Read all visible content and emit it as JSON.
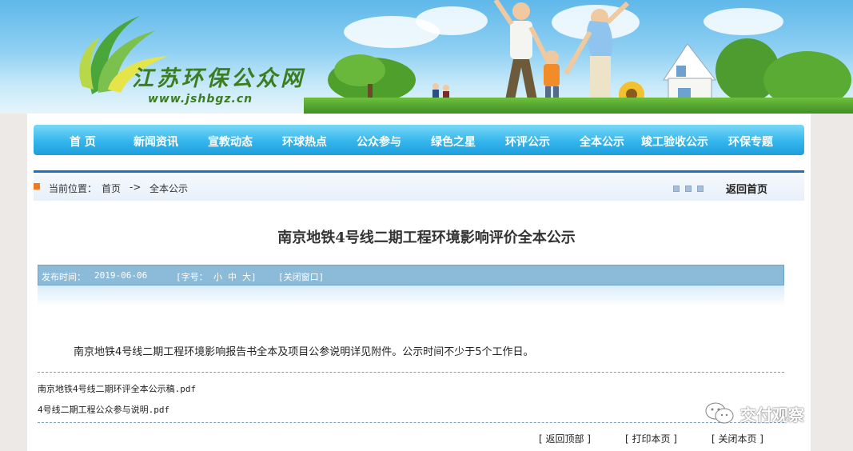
{
  "header": {
    "site_name": "江苏环保公众网",
    "site_url": "www.jshbgz.cn"
  },
  "nav": {
    "items": [
      "首  页",
      "新闻资讯",
      "宣教动态",
      "环球热点",
      "公众参与",
      "绿色之星",
      "环评公示",
      "全本公示",
      "竣工验收公示",
      "环保专题"
    ]
  },
  "breadcrumb": {
    "label": "当前位置：",
    "home": "首页",
    "arrow": "->",
    "current": "全本公示",
    "back": "返回首页"
  },
  "article": {
    "title": "南京地铁4号线二期工程环境影响评价全本公示",
    "publish_label": "发布时间：",
    "publish_date": "2019-06-06",
    "font_size_label": "[字号：",
    "font_small": "小",
    "font_medium": "中",
    "font_large": "大]",
    "close_window": "[关闭窗口]",
    "body": "南京地铁4号线二期工程环境影响报告书全本及项目公参说明详见附件。公示时间不少于5个工作日。",
    "attachments": [
      "南京地铁4号线二期环评全本公示稿.pdf",
      "4号线二期工程公众参与说明.pdf"
    ]
  },
  "footer": {
    "back_top": "[  返回顶部  ]",
    "print": "[  打印本页  ]",
    "close": "[  关闭本页  ]"
  },
  "watermark": {
    "text": "交付观察",
    "icon": "wechat-icon"
  },
  "colors": {
    "nav_top": "#79d9f8",
    "nav_bottom": "#1e9fdd",
    "crumb_border": "#1d6fc2",
    "meta_bar": "#8bbbd9",
    "logo_green": "#3b7d1f"
  }
}
